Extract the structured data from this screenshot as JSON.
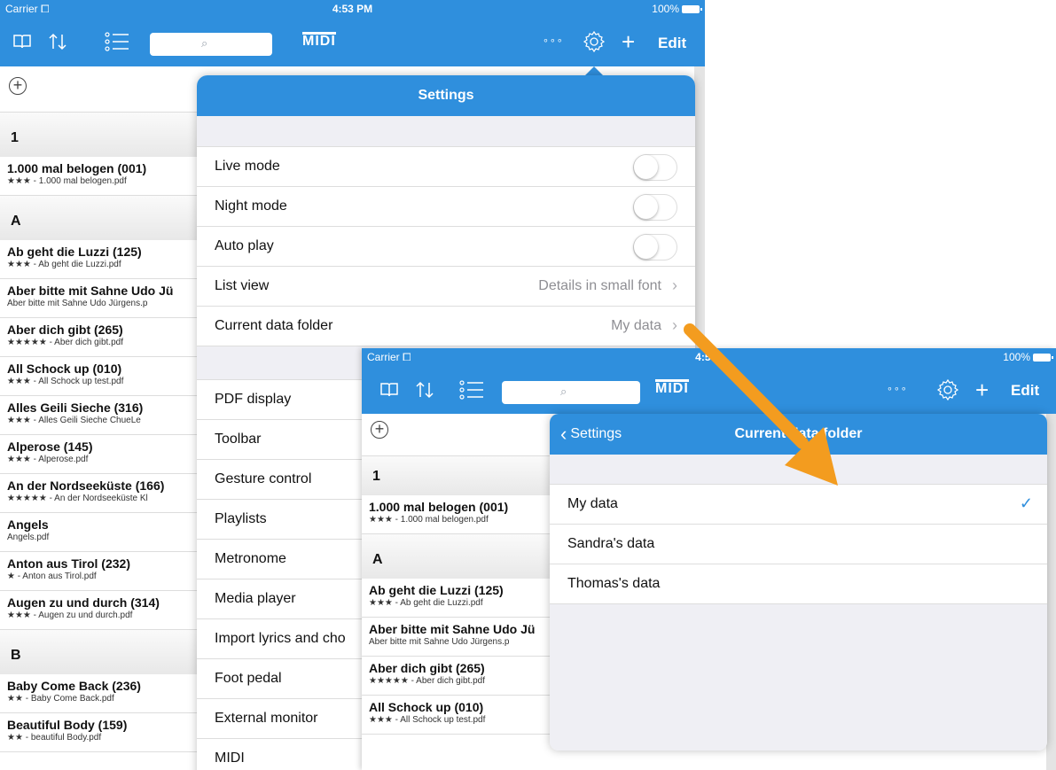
{
  "colors": {
    "accent": "#2f8fdd",
    "arrow": "#f39c1f"
  },
  "status": {
    "carrier": "Carrier",
    "time": "4:53 PM",
    "time2": "4:5  M",
    "battery": "100%"
  },
  "toolbar": {
    "icons": [
      "book-icon",
      "sort-icon",
      "list-icon",
      "search-icon",
      "midi-logo",
      "more-icon",
      "gear-icon",
      "plus-icon"
    ],
    "more": "∘∘∘",
    "midi": "MIDI",
    "edit": "Edit"
  },
  "songs": {
    "sections": [
      {
        "letter": "1",
        "items": [
          {
            "title": "1.000 mal belogen (001)",
            "sub": "★★★ - 1.000 mal belogen.pdf"
          }
        ]
      },
      {
        "letter": "A",
        "items": [
          {
            "title": "Ab geht die Luzzi (125)",
            "sub": "★★★ - Ab geht die Luzzi.pdf"
          },
          {
            "title": "Aber bitte mit Sahne Udo Jü",
            "sub": "Aber bitte mit Sahne Udo Jürgens.p"
          },
          {
            "title": "Aber dich gibt (265)",
            "sub": "★★★★★ - Aber dich gibt.pdf"
          },
          {
            "title": "All Schock up (010)",
            "sub": "★★★ - All Schock up test.pdf"
          },
          {
            "title": "Alles Geili Sieche (316)",
            "sub": "★★★ - Alles Geili Sieche   ChueLe"
          },
          {
            "title": "Alperose (145)",
            "sub": "★★★ - Alperose.pdf"
          },
          {
            "title": "An der Nordseeküste (166)",
            "sub": "★★★★★ - An der Nordseeküste Kl"
          },
          {
            "title": "Angels",
            "sub": "Angels.pdf"
          },
          {
            "title": "Anton aus Tirol (232)",
            "sub": "★ - Anton aus Tirol.pdf"
          },
          {
            "title": "Augen zu und durch (314)",
            "sub": "★★★ - Augen zu und durch.pdf"
          }
        ]
      },
      {
        "letter": "B",
        "items": [
          {
            "title": "Baby Come Back (236)",
            "sub": "★★ - Baby Come Back.pdf"
          },
          {
            "title": "Beautiful Body (159)",
            "sub": "★★ - beautiful Body.pdf"
          }
        ]
      }
    ]
  },
  "settings": {
    "title": "Settings",
    "group1": [
      {
        "label": "Live mode",
        "type": "toggle"
      },
      {
        "label": "Night mode",
        "type": "toggle"
      },
      {
        "label": "Auto play",
        "type": "toggle"
      },
      {
        "label": "List view",
        "value": "Details in small font"
      },
      {
        "label": "Current data folder",
        "value": "My data"
      }
    ],
    "group2": [
      "PDF display",
      "Toolbar",
      "Gesture control",
      "Playlists",
      "Metronome",
      "Media player",
      "Import lyrics and cho",
      "Foot pedal",
      "External monitor",
      "MIDI"
    ]
  },
  "datafolder": {
    "back": "Settings",
    "title": "Current data folder",
    "items": [
      "My data",
      "Sandra's data",
      "Thomas's data"
    ],
    "selected": "My data"
  }
}
